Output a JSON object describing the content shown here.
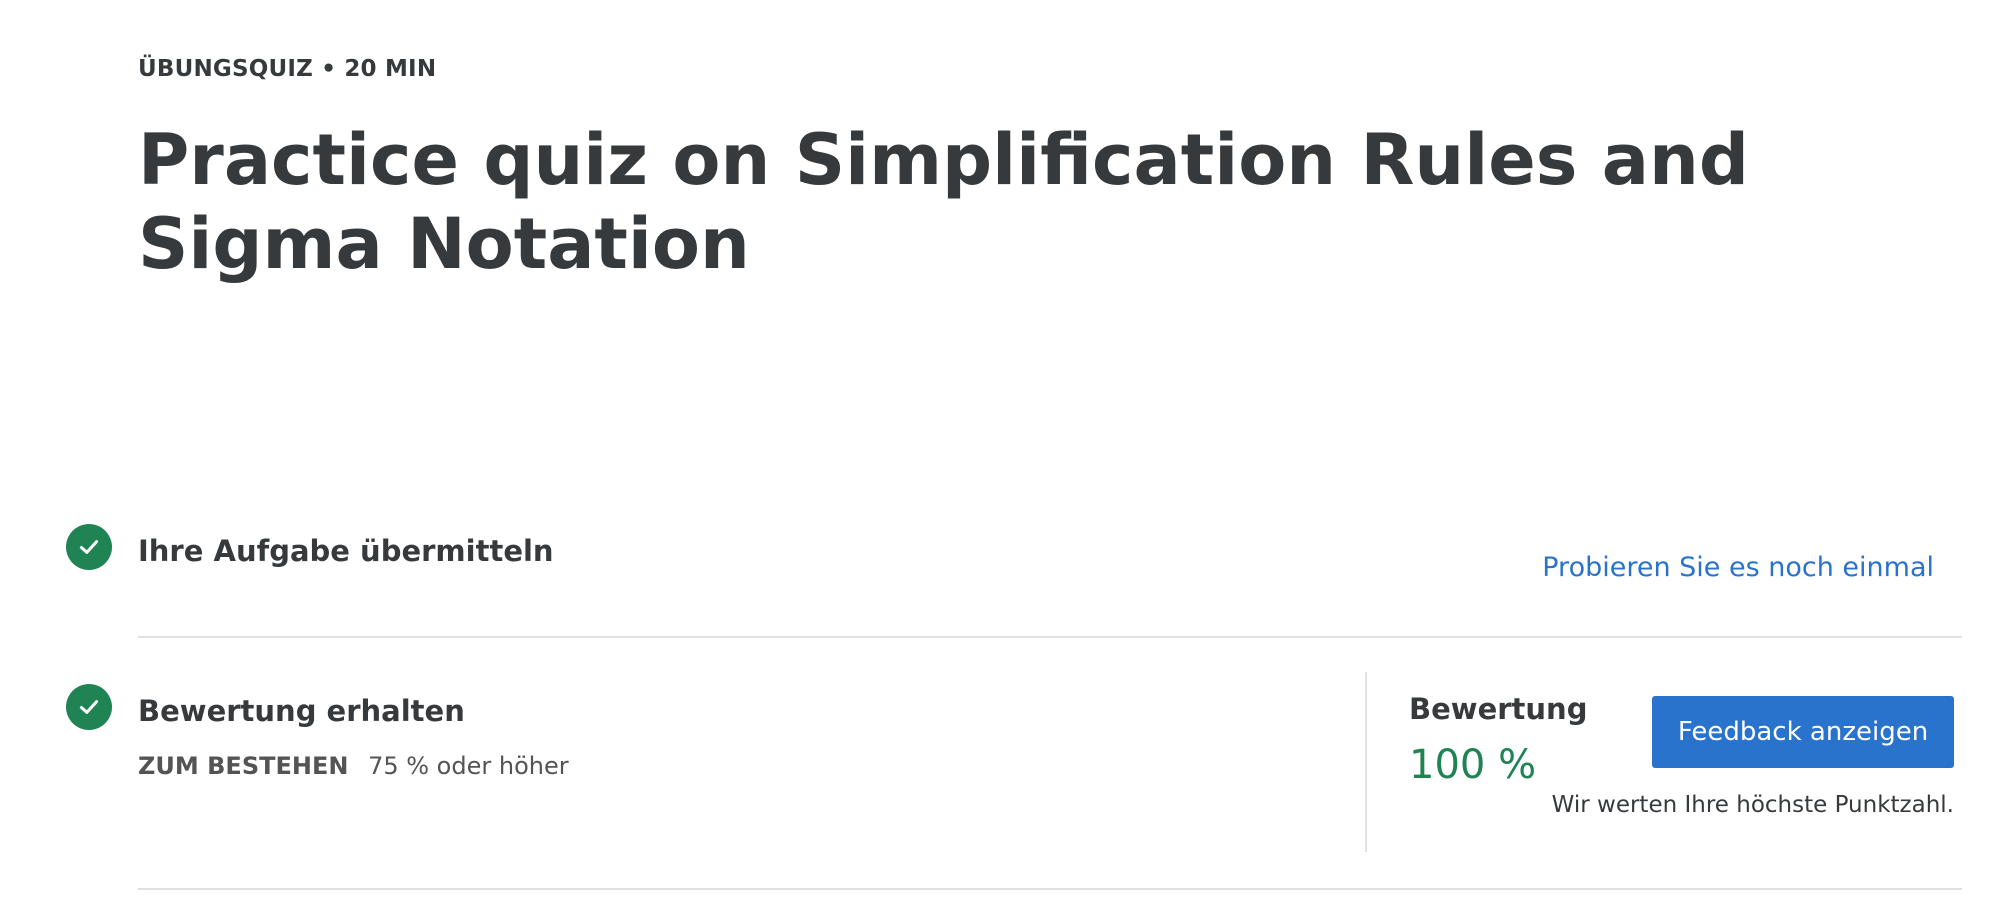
{
  "header": {
    "eyebrow": "ÜBUNGSQUIZ • 20 MIN",
    "title": "Practice quiz on Simplification Rules and Sigma Notation"
  },
  "steps": [
    {
      "title": "Ihre Aufgabe übermitteln",
      "icon": "check-circle-icon",
      "status": "done"
    },
    {
      "title": "Bewertung erhalten",
      "icon": "check-circle-icon",
      "status": "done"
    }
  ],
  "retry_link": "Probieren Sie es noch einmal",
  "pass": {
    "label": "ZUM BESTEHEN",
    "value": "75 % oder höher"
  },
  "grade": {
    "label": "Bewertung",
    "value": "100 %",
    "feedback_button": "Feedback anzeigen",
    "note": "Wir werten Ihre höchste Punktzahl."
  },
  "colors": {
    "accent": "#2a73cc",
    "success": "#1f8354",
    "text": "#373a3c"
  }
}
